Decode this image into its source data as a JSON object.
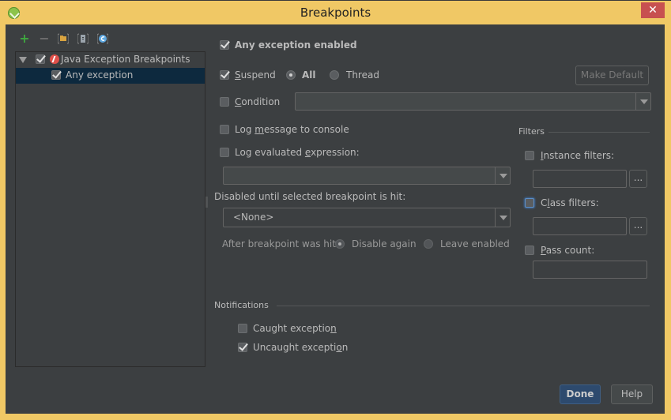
{
  "window": {
    "title": "Breakpoints",
    "app_icon": "android-studio-icon",
    "close_glyph": "✕"
  },
  "toolbar": {
    "add": "+",
    "remove": "−",
    "icons": [
      "add-icon",
      "remove-icon",
      "group-by-package-icon",
      "group-by-file-icon",
      "group-by-class-icon"
    ]
  },
  "tree": {
    "items": [
      {
        "label": "Java Exception Breakpoints",
        "checked": true,
        "expanded": true
      },
      {
        "label": "Any exception",
        "checked": true,
        "selected": true
      }
    ]
  },
  "details": {
    "enabled_label": "Any exception enabled",
    "suspend_label": "Suspend",
    "suspend_all": "All",
    "suspend_thread": "Thread",
    "make_default": "Make Default",
    "condition_label": "Condition",
    "condition_value": "",
    "log_message_label": "Log message to console",
    "log_expression_label": "Log evaluated expression:",
    "log_expression_value": "",
    "disabled_until_label": "Disabled until selected breakpoint is hit:",
    "disabled_until_value": "<None>",
    "after_hit_label": "After breakpoint was hit",
    "disable_again": "Disable again",
    "leave_enabled": "Leave enabled"
  },
  "filters": {
    "title": "Filters",
    "instance_label": "Instance filters:",
    "class_label": "Class filters:",
    "pass_count_label": "Pass count:",
    "browse": "..."
  },
  "notifications": {
    "title": "Notifications",
    "caught_label": "Caught exception",
    "uncaught_label": "Uncaught exception"
  },
  "footer": {
    "done": "Done",
    "help": "Help"
  }
}
